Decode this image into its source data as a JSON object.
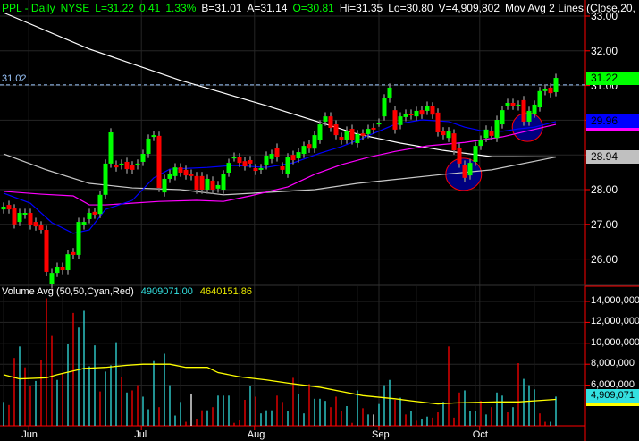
{
  "header": {
    "symbol": "PPL - Daily",
    "exchange": "NYSE",
    "last": "L=31.22",
    "change": "0.41",
    "change_pct": "1.33%",
    "bid": "B=31.01",
    "ask": "A=31.14",
    "open": "O=30.81",
    "high": "Hi=31.35",
    "low": "Lo=30.80",
    "volume": "V=4,909,802",
    "study": "Mov Avg 2 Lines (Close,20, ..."
  },
  "volume_header": {
    "title": "Volume Avg (50,50,Cyan,Red)",
    "volume_value": "4909071.00",
    "avg_value": "4640151.86"
  },
  "colors": {
    "up": "#00ff00",
    "down": "#ff0000",
    "ma20": "#0000ff",
    "ma50": "#ff00ff",
    "ma_white": "#ffffff",
    "ma_gray": "#c8c8c8",
    "vol_up": "#33e0e0",
    "vol_down": "#ff0000",
    "vol_avg": "#ffff00",
    "annotation": "#000080"
  },
  "chart_data": [
    {
      "type": "candlestick",
      "title": "PPL - Daily",
      "ylim": [
        25.2,
        33.3
      ],
      "yticks": [
        "33.00",
        "32.00",
        "31.00",
        "30.00",
        "29.00",
        "28.00",
        "27.00",
        "26.00"
      ],
      "xticks": [
        {
          "label": "Jun",
          "bar": 4.7
        },
        {
          "label": "Jul",
          "bar": 25.7
        },
        {
          "label": "Aug",
          "bar": 46.8
        },
        {
          "label": "Sep",
          "bar": 70
        },
        {
          "label": "Oct",
          "bar": 88.8
        }
      ],
      "reference_line": {
        "label": "31.02",
        "value": 31.02
      },
      "last_tags": [
        {
          "label": "31.22",
          "value": 31.22,
          "color": "#00ff00"
        },
        {
          "label": "29.96",
          "value": 29.96,
          "color": "#0000ff"
        },
        {
          "label": "28.94",
          "value": 28.94,
          "color": "#c0c0c0"
        }
      ],
      "ohlc_open_close": [
        [
          27.43,
          27.51
        ],
        [
          27.56,
          27.43
        ],
        [
          27.46,
          27.0
        ],
        [
          27.07,
          27.33
        ],
        [
          27.28,
          27.33
        ],
        [
          27.33,
          26.97
        ],
        [
          27.07,
          26.94
        ],
        [
          26.97,
          26.84
        ],
        [
          26.84,
          25.63
        ],
        [
          25.27,
          25.6
        ],
        [
          25.6,
          25.78
        ],
        [
          25.78,
          25.68
        ],
        [
          25.68,
          26.14
        ],
        [
          26.2,
          26.12
        ],
        [
          26.12,
          27.07
        ],
        [
          26.97,
          27.07
        ],
        [
          27.15,
          27.33
        ],
        [
          27.36,
          27.28
        ],
        [
          27.3,
          27.85
        ],
        [
          27.85,
          28.75
        ],
        [
          28.75,
          29.65
        ],
        [
          28.72,
          28.64
        ],
        [
          28.7,
          28.75
        ],
        [
          28.8,
          28.59
        ],
        [
          28.7,
          28.57
        ],
        [
          28.7,
          28.75
        ],
        [
          28.8,
          29.03
        ],
        [
          29.03,
          29.47
        ],
        [
          29.52,
          29.57
        ],
        [
          29.55,
          28.05
        ],
        [
          27.92,
          28.31
        ],
        [
          28.31,
          28.46
        ],
        [
          28.39,
          28.64
        ],
        [
          28.64,
          28.49
        ],
        [
          28.57,
          28.41
        ],
        [
          28.46,
          28.39
        ],
        [
          28.39,
          28.0
        ],
        [
          28.39,
          28.0
        ],
        [
          28.0,
          28.31
        ],
        [
          28.26,
          28.0
        ],
        [
          28.03,
          28.13
        ],
        [
          28.0,
          28.44
        ],
        [
          28.49,
          28.77
        ],
        [
          28.93,
          28.95
        ],
        [
          28.93,
          28.77
        ],
        [
          28.82,
          28.67
        ],
        [
          28.85,
          28.75
        ],
        [
          28.62,
          28.54
        ],
        [
          28.57,
          28.62
        ],
        [
          28.7,
          28.98
        ],
        [
          28.88,
          29.03
        ],
        [
          29.21,
          28.93
        ],
        [
          28.67,
          28.57
        ],
        [
          28.46,
          28.93
        ],
        [
          29.0,
          28.85
        ],
        [
          28.9,
          29.08
        ],
        [
          29.03,
          29.26
        ],
        [
          29.31,
          29.18
        ],
        [
          29.18,
          29.57
        ],
        [
          29.44,
          29.88
        ],
        [
          29.96,
          30.11
        ],
        [
          30.11,
          29.78
        ],
        [
          29.88,
          29.57
        ],
        [
          29.52,
          29.42
        ],
        [
          29.44,
          29.7
        ],
        [
          29.75,
          29.42
        ],
        [
          29.34,
          29.6
        ],
        [
          29.62,
          29.55
        ],
        [
          29.6,
          29.75
        ],
        [
          29.78,
          29.73
        ],
        [
          29.93,
          29.93
        ],
        [
          30.11,
          30.63
        ],
        [
          30.63,
          30.94
        ],
        [
          30.29,
          29.73
        ],
        [
          29.86,
          30.11
        ],
        [
          30.09,
          30.19
        ],
        [
          30.19,
          30.14
        ],
        [
          30.11,
          30.27
        ],
        [
          30.29,
          30.16
        ],
        [
          30.27,
          30.42
        ],
        [
          30.4,
          30.16
        ],
        [
          30.22,
          29.65
        ],
        [
          29.68,
          29.57
        ],
        [
          29.49,
          29.68
        ],
        [
          29.62,
          29.13
        ],
        [
          29.21,
          28.75
        ],
        [
          28.72,
          28.34
        ],
        [
          28.41,
          28.77
        ],
        [
          28.8,
          29.26
        ],
        [
          29.26,
          29.44
        ],
        [
          29.49,
          29.73
        ],
        [
          29.7,
          29.55
        ],
        [
          29.49,
          30.01
        ],
        [
          29.88,
          30.29
        ],
        [
          30.42,
          30.5
        ],
        [
          30.5,
          30.42
        ],
        [
          30.4,
          30.45
        ],
        [
          30.58,
          29.96
        ],
        [
          29.96,
          30.27
        ],
        [
          30.19,
          30.45
        ],
        [
          30.37,
          30.84
        ],
        [
          30.84,
          30.91
        ],
        [
          30.94,
          30.78
        ],
        [
          30.81,
          31.22
        ]
      ],
      "wick_extension": 0.12,
      "moving_averages": [
        {
          "name": "MA white",
          "color": "#ffffff",
          "points": [
            [
              0,
              33.1
            ],
            [
              16,
              32.05
            ],
            [
              33,
              31.15
            ],
            [
              49,
              30.42
            ],
            [
              66,
              29.6
            ],
            [
              74,
              29.34
            ],
            [
              82,
              29.13
            ],
            [
              91,
              28.95
            ],
            [
              103,
              28.94
            ]
          ]
        },
        {
          "name": "MA gray",
          "color": "#c8c8c8",
          "points": [
            [
              0,
              29.03
            ],
            [
              8,
              28.57
            ],
            [
              16,
              28.18
            ],
            [
              24,
              28.05
            ],
            [
              33,
              28.0
            ],
            [
              41,
              27.85
            ],
            [
              49,
              27.92
            ],
            [
              58,
              28.0
            ],
            [
              66,
              28.18
            ],
            [
              74,
              28.31
            ],
            [
              82,
              28.44
            ],
            [
              91,
              28.57
            ],
            [
              103,
              28.94
            ]
          ]
        },
        {
          "name": "MA 50",
          "color": "#ff00ff",
          "points": [
            [
              0,
              27.95
            ],
            [
              7,
              27.87
            ],
            [
              13,
              27.82
            ],
            [
              16,
              27.56
            ],
            [
              19,
              27.56
            ],
            [
              24,
              27.61
            ],
            [
              29,
              27.66
            ],
            [
              36,
              27.69
            ],
            [
              41,
              27.66
            ],
            [
              46,
              27.82
            ],
            [
              53,
              28.08
            ],
            [
              58,
              28.44
            ],
            [
              63,
              28.72
            ],
            [
              68,
              28.93
            ],
            [
              73,
              29.1
            ],
            [
              79,
              29.26
            ],
            [
              86,
              29.36
            ],
            [
              93,
              29.52
            ],
            [
              98,
              29.7
            ],
            [
              103,
              29.88
            ]
          ]
        },
        {
          "name": "MA 20",
          "color": "#0000ff",
          "points": [
            [
              0,
              27.9
            ],
            [
              5,
              27.61
            ],
            [
              9,
              27.05
            ],
            [
              13,
              26.74
            ],
            [
              16,
              26.84
            ],
            [
              19,
              27.43
            ],
            [
              24,
              27.69
            ],
            [
              28,
              28.34
            ],
            [
              31,
              28.59
            ],
            [
              38,
              28.64
            ],
            [
              43,
              28.7
            ],
            [
              49,
              28.64
            ],
            [
              54,
              28.77
            ],
            [
              59,
              29.05
            ],
            [
              63,
              29.24
            ],
            [
              66,
              29.42
            ],
            [
              69,
              29.62
            ],
            [
              73,
              29.88
            ],
            [
              78,
              30.01
            ],
            [
              83,
              29.96
            ],
            [
              86,
              29.8
            ],
            [
              89,
              29.7
            ],
            [
              93,
              29.68
            ],
            [
              96,
              29.75
            ],
            [
              99,
              29.8
            ],
            [
              103,
              29.96
            ]
          ]
        }
      ],
      "annotations": [
        {
          "type": "circle",
          "bar": 85.8,
          "price": 28.44
        },
        {
          "type": "circle",
          "bar": 97.7,
          "price": 29.8
        }
      ]
    },
    {
      "type": "bar",
      "title": "Volume Avg (50,50,Cyan,Red)",
      "units": "millions",
      "yticks": [
        "14,000,000",
        "12,000,000",
        "10,000,000",
        "8,000,000",
        "6,000,000"
      ],
      "last_tag": "4,909,071",
      "values": [
        4.4,
        4.1,
        8.6,
        9.7,
        7.7,
        5.9,
        6.4,
        8.4,
        14.3,
        10.7,
        6.5,
        7.1,
        9.9,
        12.9,
        11.5,
        13.1,
        7.8,
        9.8,
        5.4,
        7.3,
        7.9,
        10.1,
        6.8,
        5.3,
        5.5,
        6.0,
        4.9,
        3.7,
        8.3,
        3.9,
        9.0,
        6.0,
        3.1,
        4.4,
        2.5,
        5.2,
        2.8,
        3.6,
        3.6,
        3.9,
        5.0,
        5.0,
        5.0,
        2.4,
        2.7,
        4.6,
        5.9,
        4.9,
        3.3,
        3.6,
        3.6,
        5.0,
        4.4,
        3.5,
        6.7,
        5.2,
        3.3,
        6.1,
        4.7,
        4.7,
        4.5,
        3.9,
        4.9,
        3.5,
        4.0,
        2.4,
        5.5,
        3.8,
        3.2,
        3.2,
        4.2,
        6.0,
        6.5,
        4.6,
        4.8,
        3.2,
        3.5,
        2.6,
        2.8,
        3.0,
        2.9,
        3.4,
        4.4,
        9.7,
        2.9,
        5.3,
        5.5,
        3.5,
        3.5,
        4.5,
        3.2,
        3.9,
        5.3,
        5.0,
        3.4,
        3.9,
        8.1,
        6.6,
        6.0,
        5.6,
        3.3,
        2.5,
        2.5,
        4.91
      ],
      "bar_colors": "crrcrrcrrrcrcrccccrcccrcrrcccrccccrwrrcrcccrrrcrcccrrcrccrcccrrrcrcrcwcccrcrcrccrrcrrrcccrcrccrcrcccrrc",
      "average": {
        "name": "Volume Avg 50",
        "color": "#ffff00",
        "points": [
          [
            0,
            7.0
          ],
          [
            3,
            6.6
          ],
          [
            8,
            6.7
          ],
          [
            10,
            7.0
          ],
          [
            15,
            7.6
          ],
          [
            19,
            7.7
          ],
          [
            23,
            7.9
          ],
          [
            26,
            8.0
          ],
          [
            31,
            8.0
          ],
          [
            34,
            7.7
          ],
          [
            38,
            7.7
          ],
          [
            40,
            7.2
          ],
          [
            44,
            6.8
          ],
          [
            49,
            6.5
          ],
          [
            53,
            6.2
          ],
          [
            59,
            5.8
          ],
          [
            63,
            5.4
          ],
          [
            67,
            5.0
          ],
          [
            73,
            4.7
          ],
          [
            76,
            4.5
          ],
          [
            81,
            4.2
          ],
          [
            84,
            4.3
          ],
          [
            92,
            4.4
          ],
          [
            96,
            4.4
          ],
          [
            99,
            4.5
          ],
          [
            103,
            4.64
          ]
        ]
      }
    }
  ]
}
